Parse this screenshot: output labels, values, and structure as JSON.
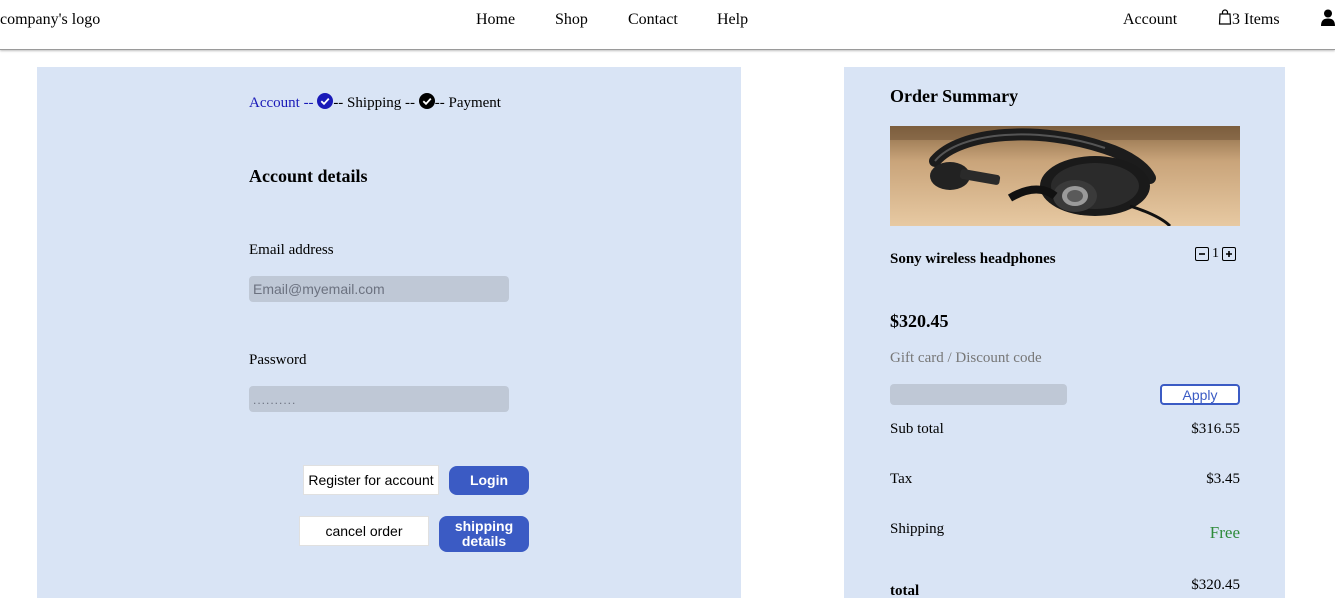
{
  "header": {
    "logo_alt": "company's logo",
    "nav": [
      "Home",
      "Shop",
      "Contact",
      "Help"
    ],
    "account": "Account",
    "cart_count": "3 Items"
  },
  "checkout": {
    "steps": {
      "account": "Account --",
      "shipping": "-- Shipping --",
      "payment": "-- Payment"
    },
    "section_title": "Account details",
    "email_label": "Email address",
    "email_placeholder": "Email@myemail.com",
    "password_label": "Password",
    "password_placeholder": "..........",
    "register_label": "Register for account",
    "login_label": "Login",
    "cancel_label": "cancel order",
    "shipping_label": "shipping details"
  },
  "summary": {
    "title": "Order Summary",
    "product_name": "Sony wireless headphones",
    "quantity": "1",
    "price": "$320.45",
    "discount_label": "Gift card / Discount code",
    "apply_label": "Apply",
    "subtotal_label": "Sub total",
    "subtotal_value": "$316.55",
    "tax_label": "Tax",
    "tax_value": "$3.45",
    "shipping_label": "Shipping",
    "shipping_value": "Free",
    "total_label": "total",
    "total_value": "$320.45"
  },
  "colors": {
    "panel_bg": "#d9e4f5",
    "primary_button": "#3b5bc4",
    "input_bg": "#bfc8d6",
    "free_text": "#2e8b3a",
    "active_step": "#1a1ab8"
  },
  "icons": [
    "check-circle-icon",
    "shopping-bag-icon",
    "user-icon",
    "minus-icon",
    "plus-icon"
  ]
}
